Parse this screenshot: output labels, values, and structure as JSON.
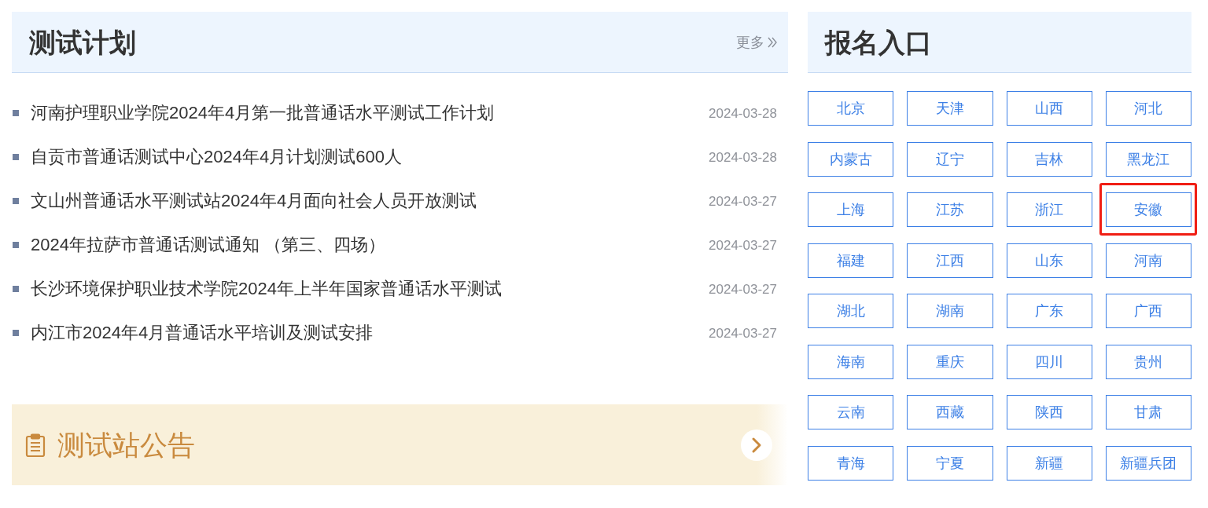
{
  "schedule": {
    "title": "测试计划",
    "more": "更多",
    "items": [
      {
        "title": "河南护理职业学院2024年4月第一批普通话水平测试工作计划",
        "date": "2024-03-28"
      },
      {
        "title": "自贡市普通话测试中心2024年4月计划测试600人",
        "date": "2024-03-28"
      },
      {
        "title": "文山州普通话水平测试站2024年4月面向社会人员开放测试",
        "date": "2024-03-27"
      },
      {
        "title": "2024年拉萨市普通话测试通知 （第三、四场）",
        "date": "2024-03-27"
      },
      {
        "title": "长沙环境保护职业技术学院2024年上半年国家普通话水平测试",
        "date": "2024-03-27"
      },
      {
        "title": "内江市2024年4月普通话水平培训及测试安排",
        "date": "2024-03-27"
      }
    ]
  },
  "notice_banner": {
    "title": "测试站公告"
  },
  "registration": {
    "title": "报名入口",
    "provinces": [
      {
        "label": "北京",
        "highlighted": false
      },
      {
        "label": "天津",
        "highlighted": false
      },
      {
        "label": "山西",
        "highlighted": false
      },
      {
        "label": "河北",
        "highlighted": false
      },
      {
        "label": "内蒙古",
        "highlighted": false
      },
      {
        "label": "辽宁",
        "highlighted": false
      },
      {
        "label": "吉林",
        "highlighted": false
      },
      {
        "label": "黑龙江",
        "highlighted": false
      },
      {
        "label": "上海",
        "highlighted": false
      },
      {
        "label": "江苏",
        "highlighted": false
      },
      {
        "label": "浙江",
        "highlighted": false
      },
      {
        "label": "安徽",
        "highlighted": true
      },
      {
        "label": "福建",
        "highlighted": false
      },
      {
        "label": "江西",
        "highlighted": false
      },
      {
        "label": "山东",
        "highlighted": false
      },
      {
        "label": "河南",
        "highlighted": false
      },
      {
        "label": "湖北",
        "highlighted": false
      },
      {
        "label": "湖南",
        "highlighted": false
      },
      {
        "label": "广东",
        "highlighted": false
      },
      {
        "label": "广西",
        "highlighted": false
      },
      {
        "label": "海南",
        "highlighted": false
      },
      {
        "label": "重庆",
        "highlighted": false
      },
      {
        "label": "四川",
        "highlighted": false
      },
      {
        "label": "贵州",
        "highlighted": false
      },
      {
        "label": "云南",
        "highlighted": false
      },
      {
        "label": "西藏",
        "highlighted": false
      },
      {
        "label": "陕西",
        "highlighted": false
      },
      {
        "label": "甘肃",
        "highlighted": false
      },
      {
        "label": "青海",
        "highlighted": false
      },
      {
        "label": "宁夏",
        "highlighted": false
      },
      {
        "label": "新疆",
        "highlighted": false
      },
      {
        "label": "新疆兵团",
        "highlighted": false
      }
    ]
  }
}
